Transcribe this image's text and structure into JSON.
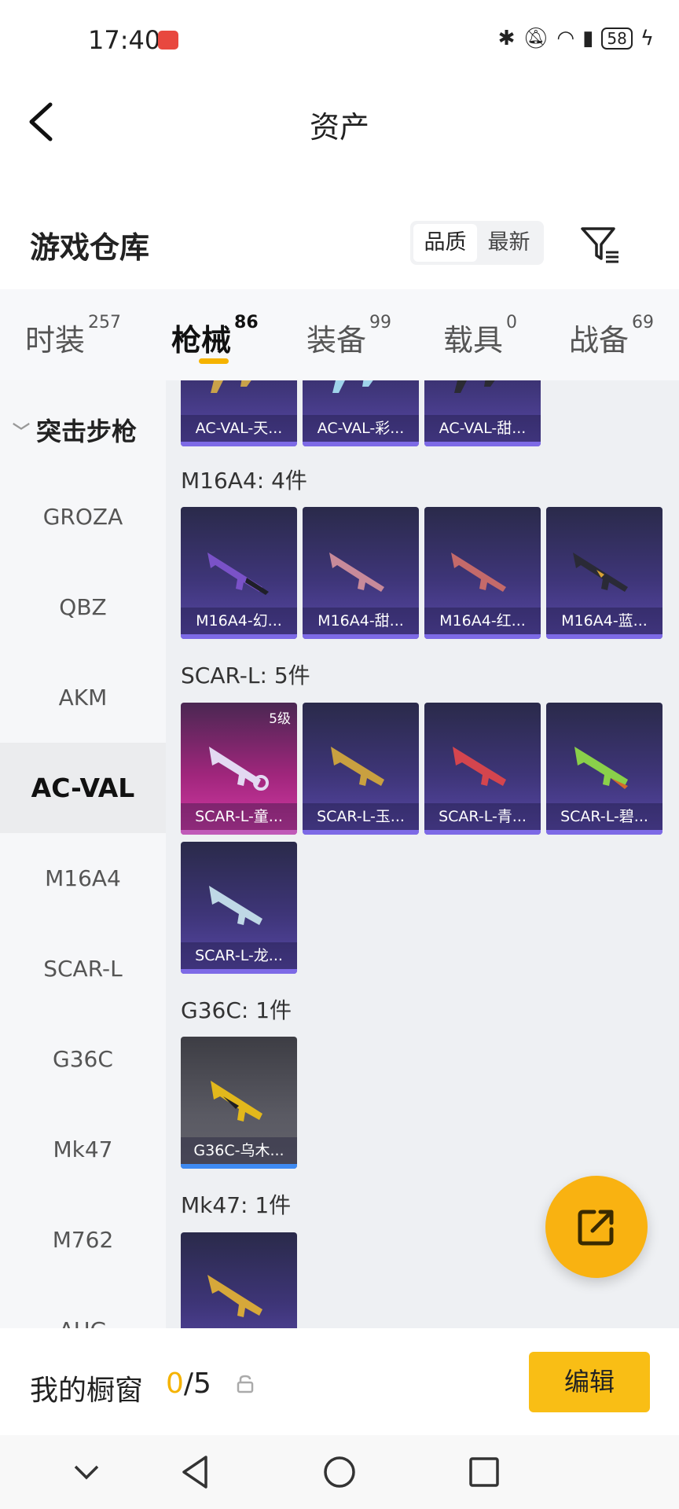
{
  "status_bar": {
    "time": "17:40",
    "battery": "58"
  },
  "header": {
    "title": "资产"
  },
  "warehouse": {
    "title": "游戏仓库",
    "sort_options": [
      "品质",
      "最新"
    ],
    "active_sort": "品质"
  },
  "tabs": [
    {
      "label": "时装",
      "count": "257"
    },
    {
      "label": "枪械",
      "count": "86",
      "active": true
    },
    {
      "label": "装备",
      "count": "99"
    },
    {
      "label": "载具",
      "count": "0"
    },
    {
      "label": "战备",
      "count": "69"
    }
  ],
  "sidenav": {
    "category": "突击步枪",
    "items": [
      "GROZA",
      "QBZ",
      "AKM",
      "AC-VAL",
      "M16A4",
      "SCAR-L",
      "G36C",
      "Mk47",
      "M762",
      "AUG"
    ],
    "active": "AC-VAL"
  },
  "groups": {
    "acval": {
      "cards": [
        "AC-VAL-天...",
        "AC-VAL-彩...",
        "AC-VAL-甜..."
      ]
    },
    "m16a4": {
      "label": "M16A4: 4件",
      "cards": [
        "M16A4-幻...",
        "M16A4-甜...",
        "M16A4-红...",
        "M16A4-蓝..."
      ]
    },
    "scarl": {
      "label": "SCAR-L: 5件",
      "cards": [
        "SCAR-L-童...",
        "SCAR-L-玉...",
        "SCAR-L-青...",
        "SCAR-L-碧...",
        "SCAR-L-龙..."
      ],
      "level_badge": "5级"
    },
    "g36c": {
      "label": "G36C: 1件",
      "cards": [
        "G36C-乌木..."
      ]
    },
    "mk47": {
      "label": "Mk47: 1件"
    }
  },
  "bottom_bar": {
    "label": "我的橱窗",
    "count_current": "0",
    "count_total": "/5",
    "edit_label": "编辑"
  },
  "colors": {
    "accent": "#f9be15",
    "card_purple": "#3e3578",
    "card_pink": "#d53aa6",
    "card_gray": "#5a5a63"
  }
}
